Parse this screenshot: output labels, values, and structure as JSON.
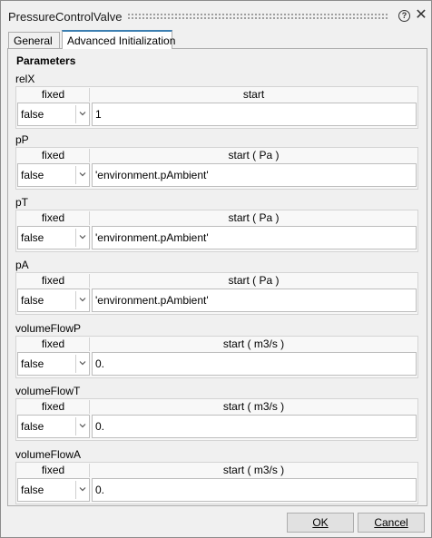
{
  "window": {
    "title": "PressureControlValve"
  },
  "tabs": [
    {
      "label": "General",
      "active": false
    },
    {
      "label": "Advanced Initialization",
      "active": true
    }
  ],
  "panel": {
    "section_title": "Parameters"
  },
  "parameters": [
    {
      "name": "relX",
      "fixed_header": "fixed",
      "start_header": "start",
      "fixed_value": "false",
      "start_value": "1"
    },
    {
      "name": "pP",
      "fixed_header": "fixed",
      "start_header": "start ( Pa )",
      "fixed_value": "false",
      "start_value": "'environment.pAmbient'"
    },
    {
      "name": "pT",
      "fixed_header": "fixed",
      "start_header": "start ( Pa )",
      "fixed_value": "false",
      "start_value": "'environment.pAmbient'"
    },
    {
      "name": "pA",
      "fixed_header": "fixed",
      "start_header": "start ( Pa )",
      "fixed_value": "false",
      "start_value": "'environment.pAmbient'"
    },
    {
      "name": "volumeFlowP",
      "fixed_header": "fixed",
      "start_header": "start ( m3/s )",
      "fixed_value": "false",
      "start_value": "0."
    },
    {
      "name": "volumeFlowT",
      "fixed_header": "fixed",
      "start_header": "start ( m3/s )",
      "fixed_value": "false",
      "start_value": "0."
    },
    {
      "name": "volumeFlowA",
      "fixed_header": "fixed",
      "start_header": "start ( m3/s )",
      "fixed_value": "false",
      "start_value": "0."
    }
  ],
  "buttons": {
    "ok_label": "OK",
    "cancel_label": "Cancel"
  },
  "icons": {
    "help": "help-icon",
    "close": "close-icon",
    "dropdown": "chevron-down-icon"
  },
  "colors": {
    "active_tab_accent": "#3c7fb1",
    "background": "#f0f0f0"
  }
}
